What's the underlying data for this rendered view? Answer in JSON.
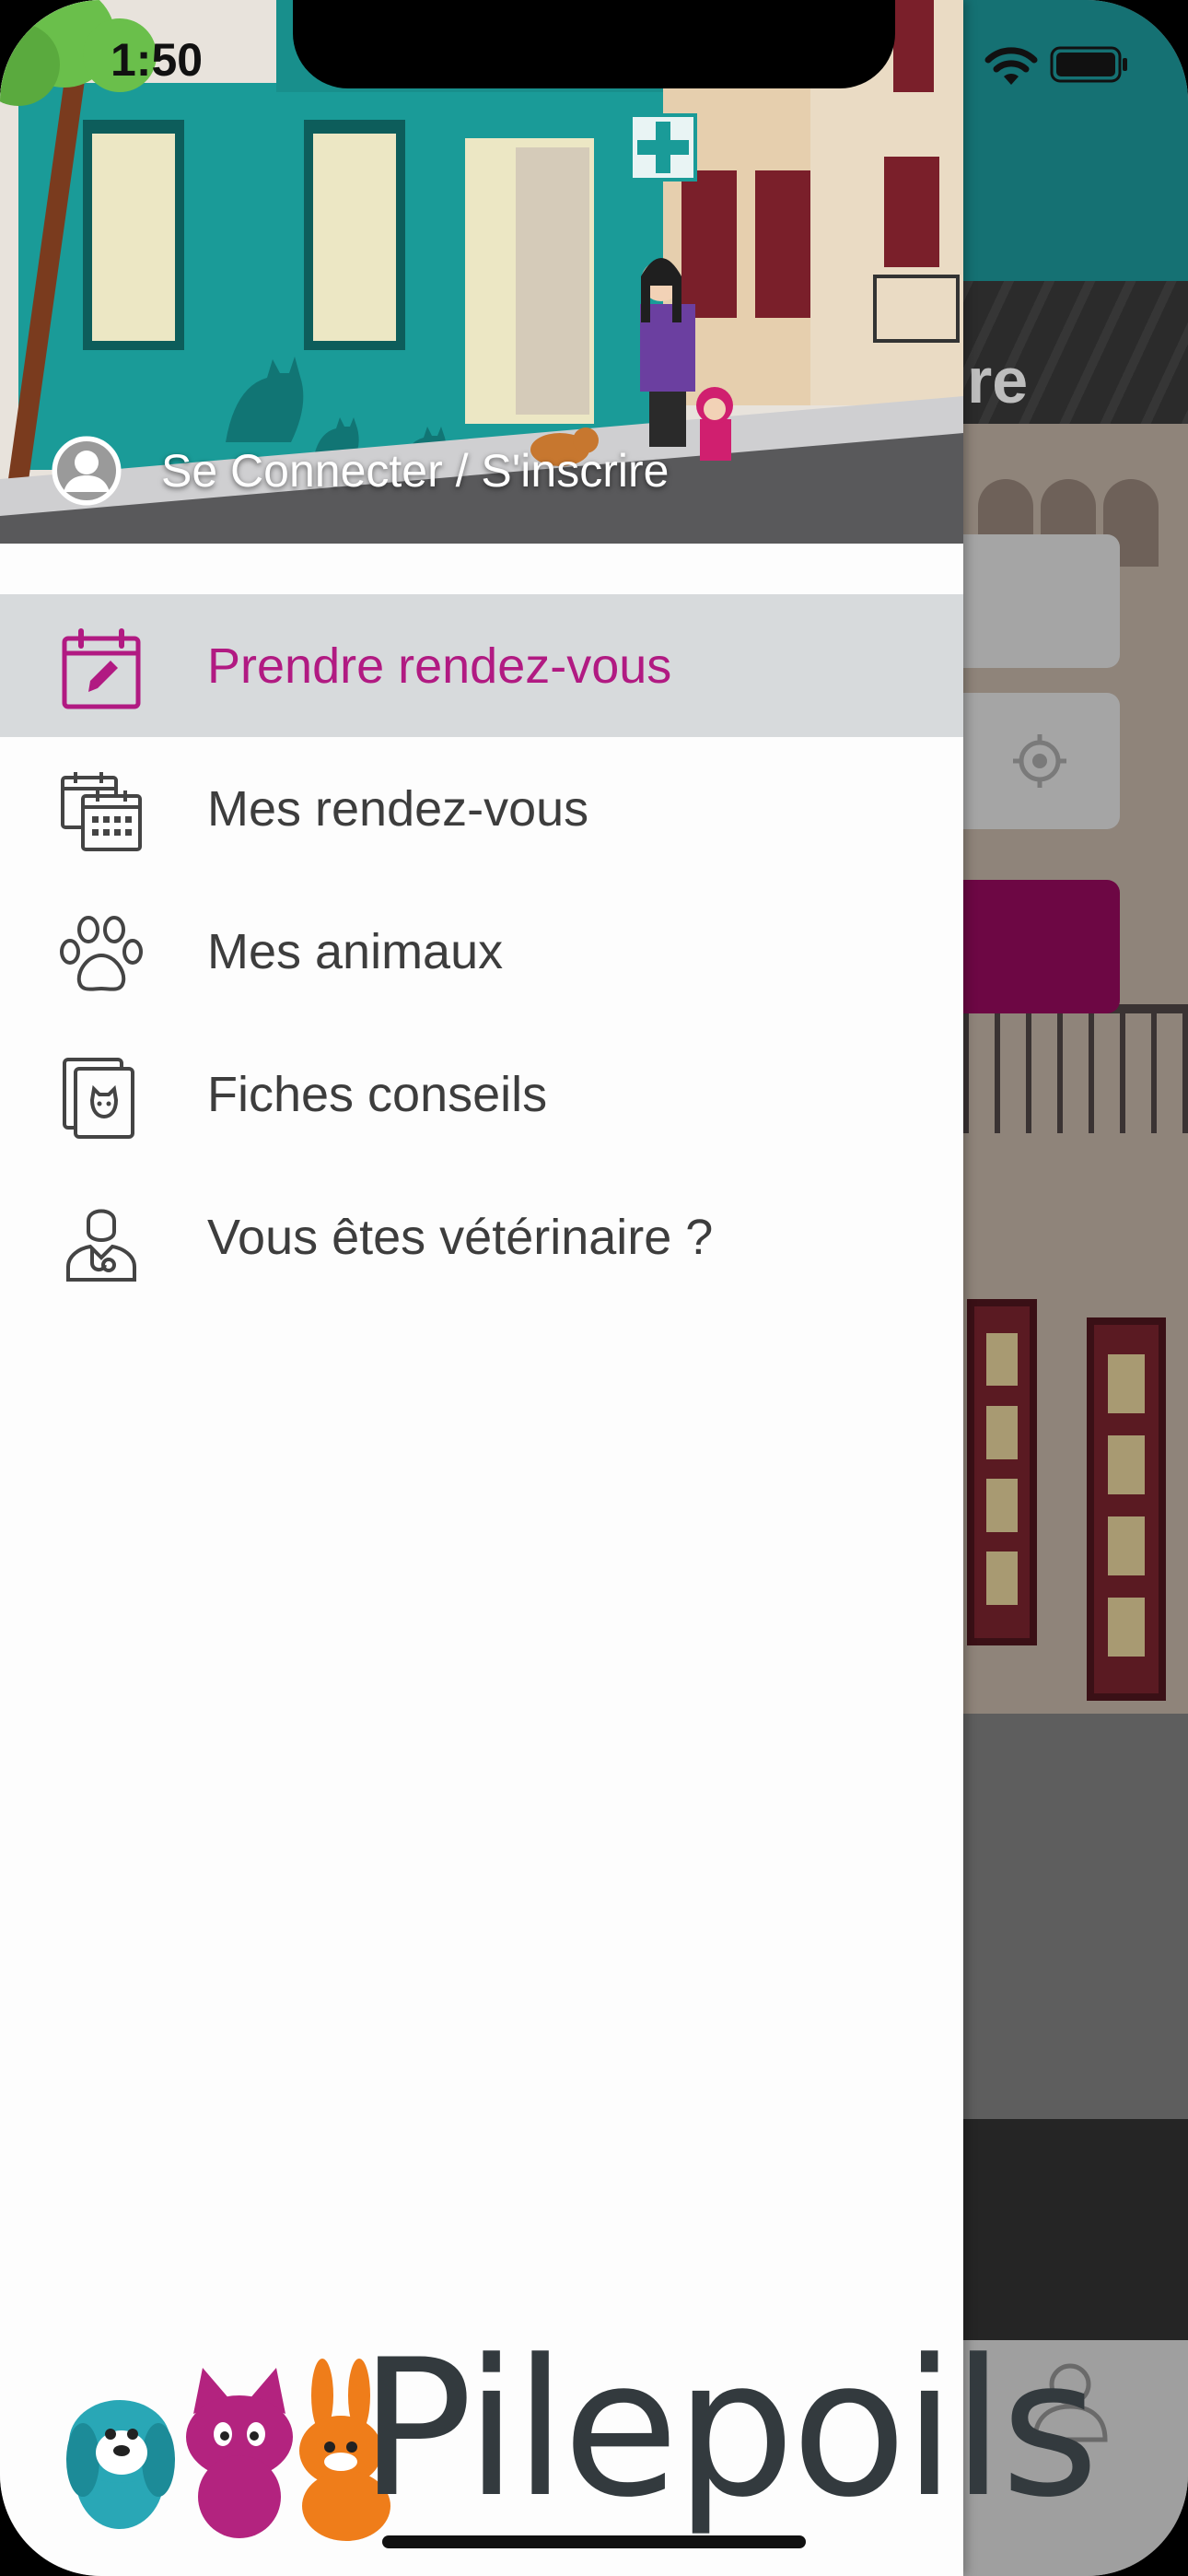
{
  "status_bar": {
    "time": "1:50",
    "icons": [
      "wifi-icon",
      "battery-icon"
    ]
  },
  "background_screen": {
    "title_fragment": "re",
    "icons": [
      "locate-icon",
      "profile-tab-icon"
    ],
    "colors": {
      "topbar": "#157173",
      "cta": "#6d0744"
    }
  },
  "drawer": {
    "login_label": "Se Connecter / S'inscrire",
    "menu": [
      {
        "label": "Prendre rendez-vous",
        "icon": "calendar-edit-icon",
        "active": true
      },
      {
        "label": "Mes rendez-vous",
        "icon": "calendar-stack-icon",
        "active": false
      },
      {
        "label": "Mes animaux",
        "icon": "paw-icon",
        "active": false
      },
      {
        "label": "Fiches conseils",
        "icon": "cat-file-icon",
        "active": false
      },
      {
        "label": "Vous êtes vétérinaire ?",
        "icon": "veterinarian-icon",
        "active": false
      }
    ],
    "colors": {
      "active_text": "#b11a82",
      "active_bg": "#d7dadc",
      "text": "#3d3d3d"
    }
  },
  "brand": {
    "name": "Pilepoils",
    "mascots": [
      "dog",
      "cat",
      "rabbit"
    ],
    "mascot_colors": [
      "#29a7b6",
      "#b3237f",
      "#ef7d1a"
    ]
  }
}
